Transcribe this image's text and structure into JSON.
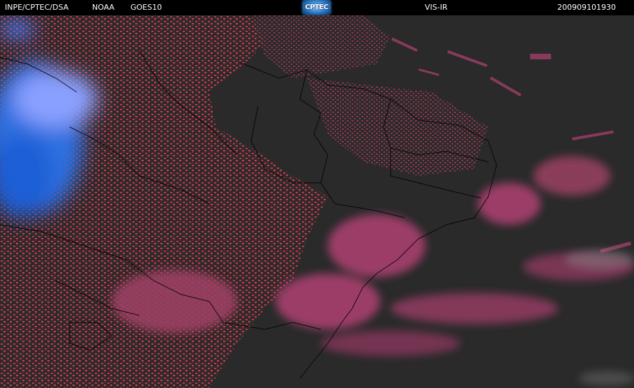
{
  "header": {
    "source": "INPE/CPTEC/DSA",
    "agency": "NOAA",
    "satellite": "GOES10",
    "logo_text": "CPTEC",
    "channel": "VIS-IR",
    "timestamp": "200909101930"
  },
  "colors": {
    "background": "#2a2a2a",
    "low_cloud": "#c8344a",
    "mid_cloud": "#a8406e",
    "high_cloud": "#2f6fe0",
    "borders": "#000000"
  }
}
